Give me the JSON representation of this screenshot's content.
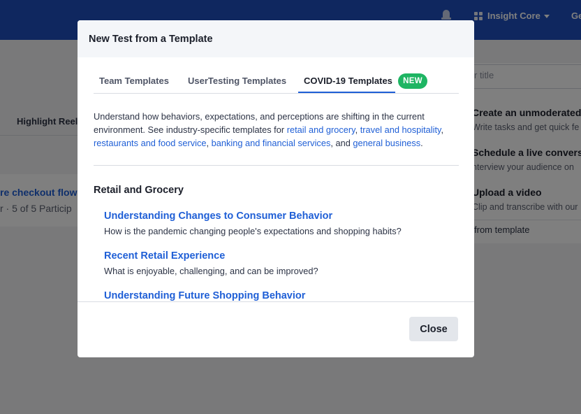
{
  "topbar": {
    "app_switcher_label": "Insight Core",
    "user_label": "Ge"
  },
  "background": {
    "tab_label": "Highlight Reels",
    "card": {
      "title": "re checkout flow",
      "meta": "r · 5 of 5 Particip"
    },
    "title_input_placeholder": "r title",
    "options": [
      {
        "title": "Create an unmoderated",
        "desc": "Write tasks and get quick fe"
      },
      {
        "title": "Schedule a live convers",
        "desc": "nterview your audience on"
      },
      {
        "title": "Upload a video",
        "desc": "Clip and transcribe with our"
      }
    ],
    "from_template_label": "from template"
  },
  "modal": {
    "title": "New Test from a Template",
    "tabs": [
      {
        "label": "Team Templates",
        "active": false
      },
      {
        "label": "UserTesting Templates",
        "active": false
      },
      {
        "label": "COVID-19 Templates",
        "active": true
      }
    ],
    "new_badge": "NEW",
    "intro": {
      "text1": "Understand how behaviors, expectations, and perceptions are shifting in the current environment. See industry-specific templates for ",
      "link1": "retail and grocery",
      "sep1": ", ",
      "link2": "travel and hospitality",
      "sep2": ", ",
      "link3": "restaurants and food service",
      "sep3": ", ",
      "link4": "banking and financial services",
      "sep4": ", and ",
      "link5": "general business",
      "end": "."
    },
    "section_title": "Retail and Grocery",
    "templates": [
      {
        "title": "Understanding Changes to Consumer Behavior",
        "desc": "How is the pandemic changing people's expectations and shopping habits?"
      },
      {
        "title": "Recent Retail Experience",
        "desc": "What is enjoyable, challenging, and can be improved?"
      },
      {
        "title": "Understanding Future Shopping Behavior",
        "desc": ""
      }
    ],
    "close_label": "Close"
  }
}
